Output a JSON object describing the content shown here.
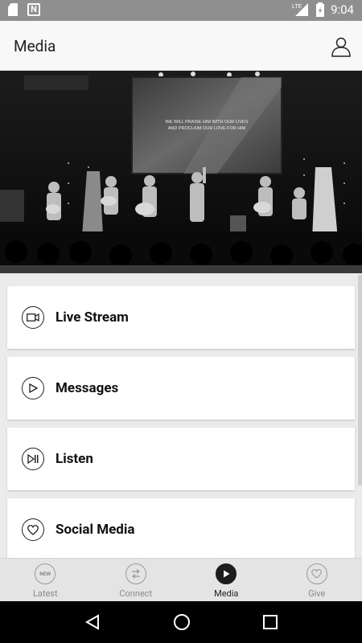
{
  "status_bar": {
    "time": "9:04",
    "network": "LTE"
  },
  "app_bar": {
    "title": "Media"
  },
  "hero": {
    "screen_text_line1": "WE WILL PRAISE HIM WITH OUR LIVES",
    "screen_text_line2": "AND PROCLAIM OUR LOVE FOR HIM"
  },
  "media_items": [
    {
      "label": "Live Stream",
      "icon": "video-camera-icon"
    },
    {
      "label": "Messages",
      "icon": "play-icon"
    },
    {
      "label": "Listen",
      "icon": "play-pause-icon"
    },
    {
      "label": "Social Media",
      "icon": "heart-icon"
    }
  ],
  "tabs": [
    {
      "label": "Latest",
      "icon": "new-badge-icon",
      "active": false,
      "badge_text": "NEW"
    },
    {
      "label": "Connect",
      "icon": "exchange-arrows-icon",
      "active": false
    },
    {
      "label": "Media",
      "icon": "play-icon",
      "active": true
    },
    {
      "label": "Give",
      "icon": "heart-icon",
      "active": false
    }
  ],
  "colors": {
    "app_bar_bg": "#f8f8f8",
    "tab_active": "#1c1c1c",
    "tab_inactive": "#8a8a8a"
  }
}
